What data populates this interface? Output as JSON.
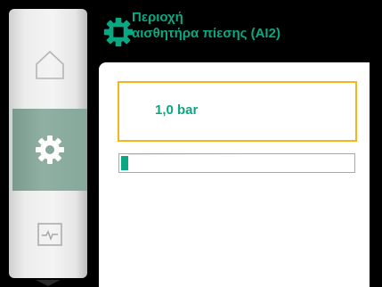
{
  "header": {
    "title_line1": "Περιοχή",
    "title_line2": "αισθητήρα πίεσης (AI2)",
    "icon": "gear-icon"
  },
  "nav": {
    "items": [
      {
        "icon": "home-icon",
        "selected": false
      },
      {
        "icon": "gear-icon",
        "selected": true
      },
      {
        "icon": "diagnostics-icon",
        "selected": false
      }
    ],
    "scroll_icon": "chevron-down-icon"
  },
  "main": {
    "value": "1,0 bar",
    "progress_fraction": 0.03
  },
  "colors": {
    "accent": "#0aa882",
    "focus": "#f6b51b",
    "selected_nav": "#86a89b"
  }
}
